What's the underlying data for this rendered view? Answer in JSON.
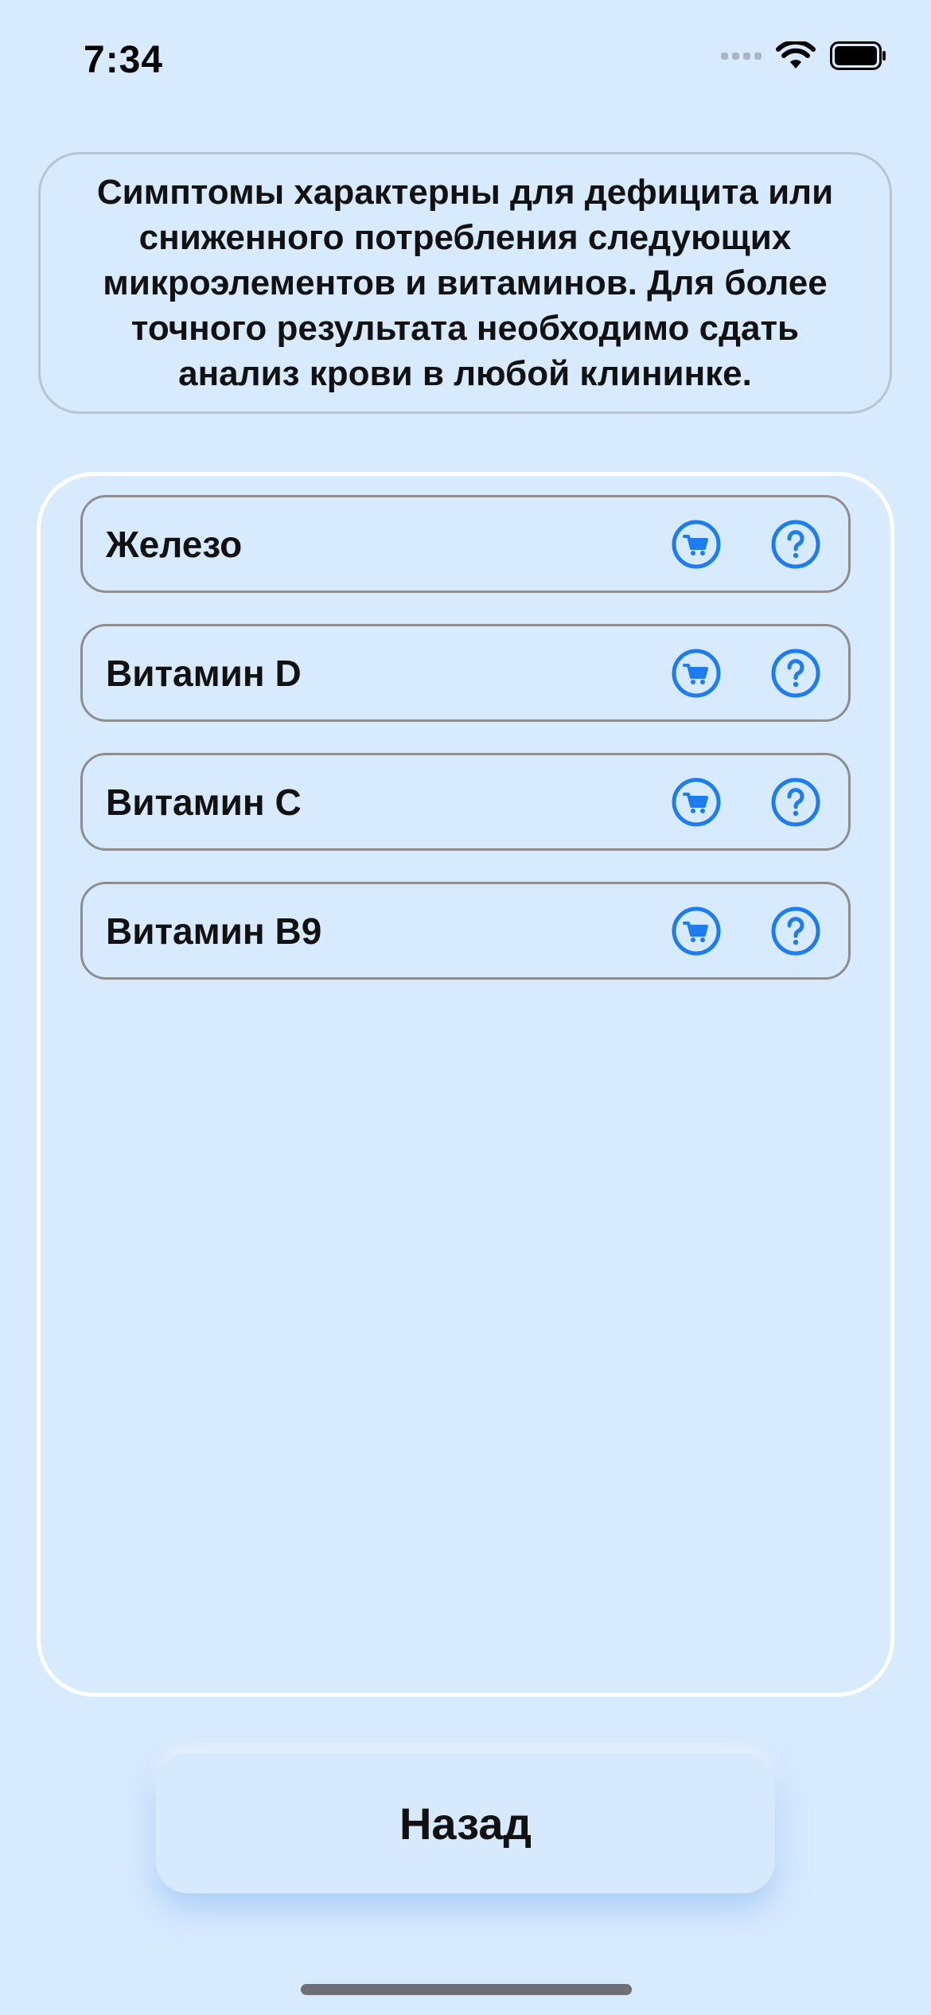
{
  "status_bar": {
    "time": "7:34"
  },
  "info": {
    "text": "Симптомы характерны для дефицита или сниженного потребления следующих микроэлементов и витаминов. Для более точного результата необходимо сдать анализ крови в любой клининке."
  },
  "items": [
    {
      "label": "Железо",
      "cart_icon": "cart-icon",
      "help_icon": "question-icon"
    },
    {
      "label": "Витамин D",
      "cart_icon": "cart-icon",
      "help_icon": "question-icon"
    },
    {
      "label": "Витамин C",
      "cart_icon": "cart-icon",
      "help_icon": "question-icon"
    },
    {
      "label": "Витамин B9",
      "cart_icon": "cart-icon",
      "help_icon": "question-icon"
    }
  ],
  "back_button": {
    "label": "Назад"
  },
  "colors": {
    "background": "#d8eafe",
    "accent": "#1c7cf0"
  }
}
